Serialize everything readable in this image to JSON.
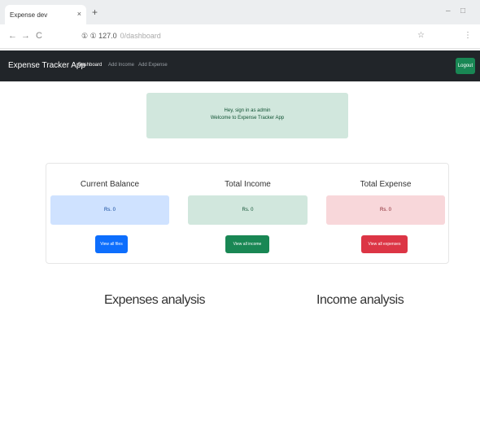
{
  "browser": {
    "tab_title": "Expense dev",
    "tab_close": "×",
    "new_tab": "+",
    "minimize": "–",
    "restore": "□",
    "close": "×",
    "back": "←",
    "forward": "→",
    "reload": "C",
    "url_host": "① ① 127.0",
    "url_path": "0/dashboard",
    "bookmark": "☆",
    "menu": "⋮"
  },
  "navbar": {
    "brand": "Expense Tracker App",
    "links": [
      "Dashboard",
      "Add Income",
      "Add Expense"
    ],
    "logout": "Logout"
  },
  "alert": {
    "line1": "Hey, sign in as admin",
    "line2": "Welcome to Expense Tracker App"
  },
  "summary": {
    "balance_title": "Current Balance",
    "balance_value": "Rs. 0",
    "balance_button": "View all files",
    "income_title": "Total Income",
    "income_value": "Rs. 0",
    "income_button": "View all income",
    "expense_title": "Total Expense",
    "expense_value": "Rs. 0",
    "expense_button": "View all expenses"
  },
  "analysis": {
    "expenses_title": "Expenses analysis",
    "income_title": "Income analysis"
  }
}
